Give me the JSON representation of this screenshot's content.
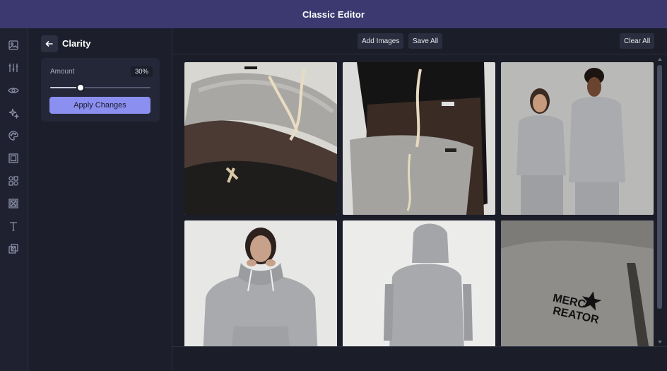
{
  "app": {
    "title": "Classic Editor"
  },
  "rail": {
    "tools": [
      "image-icon",
      "sliders-icon",
      "eye-icon",
      "sparkles-icon",
      "palette-icon",
      "frame-icon",
      "shapes-icon",
      "crop-frame-icon",
      "text-icon",
      "overlay-icon"
    ]
  },
  "panel": {
    "title": "Clarity",
    "amount_label": "Amount",
    "amount_value": "30%",
    "amount_fraction": 0.3,
    "apply_label": "Apply Changes"
  },
  "toolbar": {
    "add_images": "Add Images",
    "save_all": "Save All",
    "clear_all": "Clear All"
  },
  "gallery": {
    "images": [
      "grey and brown sweatpants pile",
      "black brown grey sweatpants stack",
      "two models in grey hoodies",
      "model pulling hoodie drawstrings",
      "model back view grey hoodie",
      "grey fabric logo close-up"
    ],
    "logo_text": "MERCH CREATOR"
  },
  "colors": {
    "topbar": "#3b3970",
    "accent": "#8a8ff0",
    "background": "#1b1d29"
  }
}
